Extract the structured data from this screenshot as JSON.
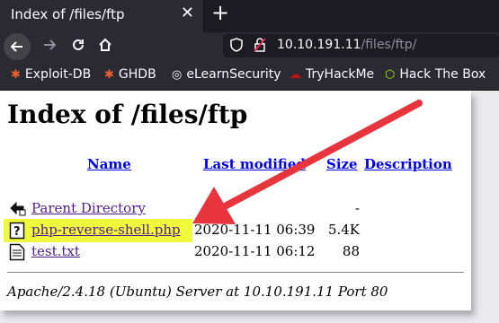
{
  "browser": {
    "tab_title": "Index of /files/ftp",
    "close_glyph": "✕",
    "newtab_glyph": "+",
    "url_host": "10.10.191.11",
    "url_path": "/files/ftp/"
  },
  "bookmarks": [
    {
      "label": "Exploit-DB",
      "icon": "bug-icon",
      "glyph": "✱",
      "color": "#e8612c"
    },
    {
      "label": "GHDB",
      "icon": "bug-icon",
      "glyph": "✱",
      "color": "#e8612c"
    },
    {
      "label": "eLearnSecurity",
      "icon": "globe-icon",
      "glyph": "◎",
      "color": "#fbfbfe"
    },
    {
      "label": "TryHackMe",
      "icon": "tryhackme-icon",
      "glyph": "☁",
      "color": "#c11111"
    },
    {
      "label": "Hack The Box",
      "icon": "cube-icon",
      "glyph": "⬡",
      "color": "#9fef00"
    }
  ],
  "page": {
    "title": "Index of /files/ftp",
    "headers": {
      "name": "Name",
      "modified": "Last modified",
      "size": "Size",
      "description": "Description"
    },
    "rows": [
      {
        "name": "Parent Directory",
        "date": "",
        "size": "-",
        "icon": "back-folder-icon"
      },
      {
        "name": "php-reverse-shell.php",
        "date": "2020-11-11 06:39",
        "size": "5.4K",
        "icon": "unknown-file-icon",
        "highlighted": true
      },
      {
        "name": "test.txt",
        "date": "2020-11-11 06:12",
        "size": "88",
        "icon": "text-file-icon"
      }
    ],
    "footer": "Apache/2.4.18 (Ubuntu) Server at 10.10.191.11 Port 80"
  },
  "colors": {
    "highlight": "#f0fa3c",
    "arrow": "#e8343c",
    "link": "#00e",
    "visited": "#551a8b"
  }
}
